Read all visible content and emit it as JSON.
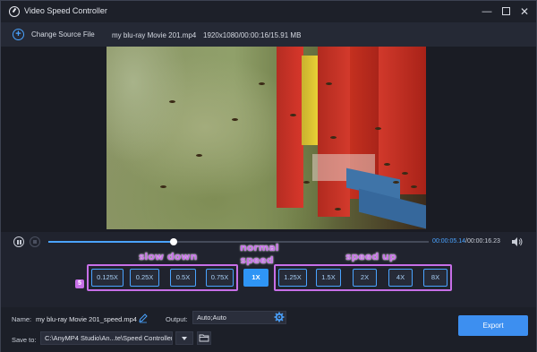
{
  "window": {
    "title": "Video Speed Controller",
    "controls": {
      "minimize": "—",
      "close": "✕"
    }
  },
  "source": {
    "change_label": "Change Source File",
    "file_name": "my blu-ray Movie 201.mp4",
    "file_info": "1920x1080/00:00:16/15.91 MB"
  },
  "player": {
    "current_time": "00:00:05.14",
    "separator": "/",
    "total_time": "00:00:16.23",
    "progress_fraction": 0.33
  },
  "speed": {
    "annotations": {
      "slow_down": "slow down",
      "normal": "normal",
      "normal_line2": "speed",
      "speed_up": "speed up",
      "badge": "5"
    },
    "options": [
      "0.125X",
      "0.25X",
      "0.5X",
      "0.75X",
      "1X",
      "1.25X",
      "1.5X",
      "2X",
      "4X",
      "8X"
    ],
    "selected": "1X"
  },
  "output": {
    "name_label": "Name:",
    "name_value": "my blu-ray Movie 201_speed.mp4",
    "output_label": "Output:",
    "output_value": "Auto;Auto",
    "save_to_label": "Save to:",
    "save_path": "C:\\AnyMP4 Studio\\An...te\\Speed Controller",
    "export_label": "Export"
  },
  "colors": {
    "accent": "#4aa3ff",
    "annotation": "#c76fe8",
    "background": "#20232e"
  }
}
